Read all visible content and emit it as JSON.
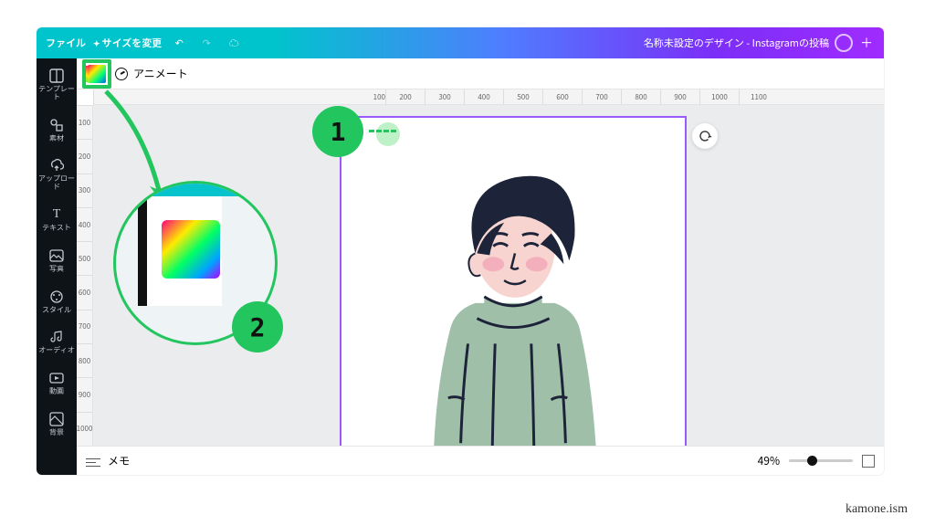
{
  "topbar": {
    "file_label": "ファイル",
    "resize_label": "サイズを変更",
    "undo": "↶",
    "redo": "↷",
    "cloud": "☁",
    "doc_title": "名称未設定のデザイン - Instagramの投稿",
    "plus": "＋"
  },
  "sidebar": {
    "items": [
      {
        "label": "テンプレート",
        "icon": "templates-icon"
      },
      {
        "label": "素材",
        "icon": "elements-icon"
      },
      {
        "label": "アップロード",
        "icon": "upload-icon"
      },
      {
        "label": "テキスト",
        "icon": "text-icon"
      },
      {
        "label": "写真",
        "icon": "photos-icon"
      },
      {
        "label": "スタイル",
        "icon": "styles-icon"
      },
      {
        "label": "オーディオ",
        "icon": "audio-icon"
      },
      {
        "label": "動画",
        "icon": "video-icon"
      },
      {
        "label": "背景",
        "icon": "background-icon"
      }
    ]
  },
  "toolbar": {
    "color_btn": "color-picker",
    "animate_label": "アニメート"
  },
  "rulers": {
    "h": [
      "100",
      "200",
      "300",
      "400",
      "500",
      "600",
      "700",
      "800",
      "900",
      "1000",
      "1100"
    ],
    "v": [
      "100",
      "200",
      "300",
      "400",
      "500",
      "600",
      "700",
      "800",
      "900",
      "1000"
    ]
  },
  "bottombar": {
    "notes_label": "メモ",
    "zoom_label": "49%"
  },
  "annotations": {
    "badge1": "1",
    "badge2": "2"
  },
  "signature": "kamone.ism",
  "illustration": {
    "description": "person-in-green-turtleneck",
    "colors": {
      "hair": "#1d2338",
      "sweater": "#9fbfa9",
      "skin": "#f7d4d0",
      "blush": "#f29fb3",
      "line": "#1d2338"
    }
  }
}
